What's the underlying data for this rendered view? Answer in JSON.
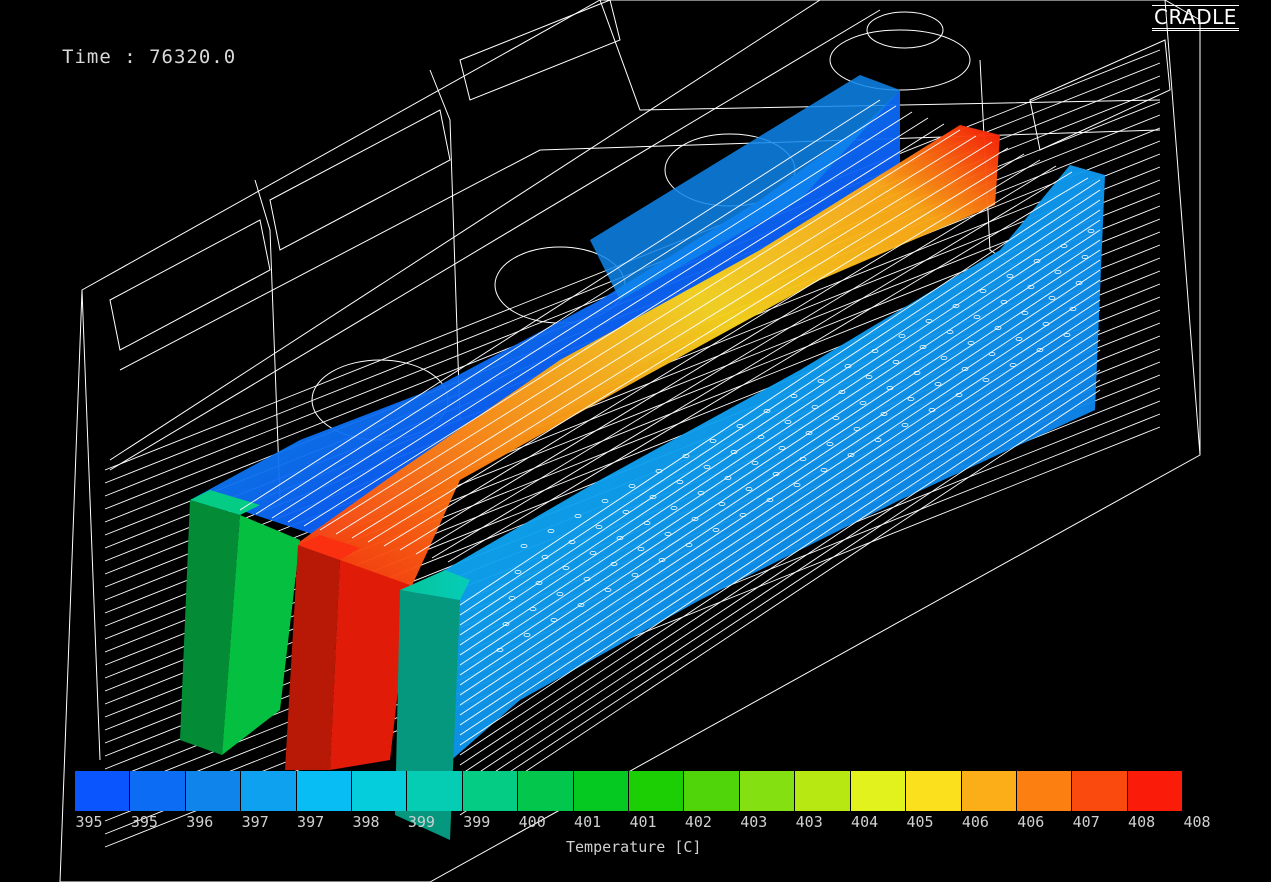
{
  "overlay": {
    "time_text": "Time : 76320.0",
    "logo_text": "CRADLE"
  },
  "legend": {
    "title": "Temperature [C]",
    "tick_labels": [
      "395",
      "395",
      "396",
      "397",
      "397",
      "398",
      "399",
      "399",
      "400",
      "401",
      "401",
      "402",
      "403",
      "403",
      "404",
      "405",
      "406",
      "406",
      "407",
      "408",
      "408"
    ],
    "colors": [
      "#0b55ff",
      "#0d6cf4",
      "#0f85ec",
      "#0ea1f0",
      "#08bdf4",
      "#06cddc",
      "#05cdb3",
      "#05cc84",
      "#02c74c",
      "#05c920",
      "#1ccf05",
      "#4fd50a",
      "#84e010",
      "#b8e812",
      "#e2f21c",
      "#fbe01e",
      "#fcae18",
      "#fc7f12",
      "#fb4a0e",
      "#fa1c08"
    ]
  },
  "scene": {
    "description_colors": {
      "wire": "#ffffff",
      "hot": "#fa1c08",
      "cold": "#0b55ff"
    }
  }
}
